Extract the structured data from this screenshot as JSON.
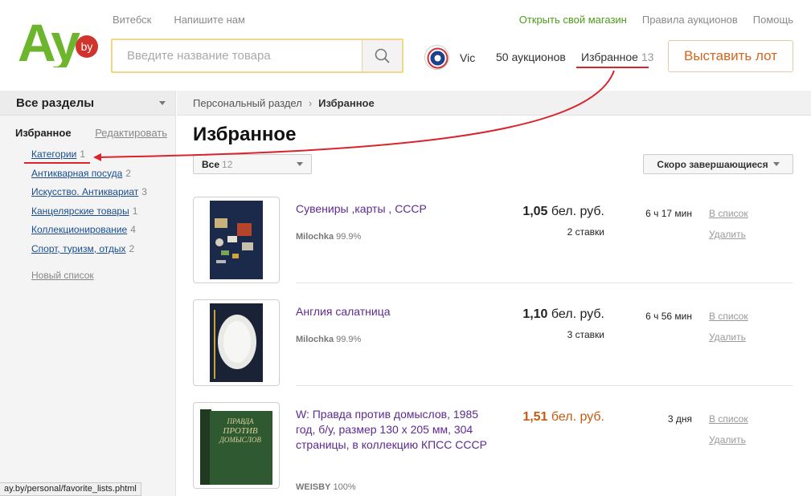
{
  "header": {
    "logo_text": "Ay",
    "logo_badge": "by",
    "city": "Витебск",
    "contact": "Напишите нам",
    "open_shop": "Открыть свой магазин",
    "rules": "Правила аукционов",
    "help": "Помощь",
    "search_placeholder": "Введите название товара",
    "user_name": "Vic",
    "auctions": "50 аукционов",
    "favorites_label": "Избранное",
    "favorites_count": "13",
    "sell_button": "Выставить лот"
  },
  "sidebar": {
    "sections": "Все разделы",
    "favorites_title": "Избранное",
    "edit": "Редактировать",
    "items": [
      {
        "label": "Категории",
        "count": "1"
      },
      {
        "label": "Антикварная посуда",
        "count": "2"
      },
      {
        "label": "Искусство. Антиквариат",
        "count": "3"
      },
      {
        "label": "Канцелярские товары",
        "count": "1"
      },
      {
        "label": "Коллекционирование",
        "count": "4"
      },
      {
        "label": "Спорт, туризм, отдых",
        "count": "2"
      }
    ],
    "new_list": "Новый список"
  },
  "main": {
    "breadcrumb_root": "Персональный раздел",
    "breadcrumb_current": "Избранное",
    "title": "Избранное",
    "filter_label": "Все",
    "filter_count": "12",
    "sort_label": "Скоро завершающиеся"
  },
  "lots": [
    {
      "title": "Сувениры ,карты , СССР",
      "seller": "Milochka",
      "rating": "99.9%",
      "price_value": "1,05",
      "price_currency": "бел. руб.",
      "bids": "2 ставки",
      "time_left": "6 ч 17 мин",
      "action_list": "В список",
      "action_delete": "Удалить",
      "price_color": "#222222"
    },
    {
      "title": "Англия салатница",
      "seller": "Milochka",
      "rating": "99.9%",
      "price_value": "1,10",
      "price_currency": "бел. руб.",
      "bids": "3 ставки",
      "time_left": "6 ч 56 мин",
      "action_list": "В список",
      "action_delete": "Удалить",
      "price_color": "#222222"
    },
    {
      "title": "W: Правда против домыслов, 1985 год, б/у, размер 130 х 205 мм, 304 страницы, в коллекцию КПСС СССР",
      "seller": "WEISBY",
      "rating": "100%",
      "price_value": "1,51",
      "price_currency": "бел. руб.",
      "bids": "",
      "time_left": "3 дня",
      "action_list": "В список",
      "action_delete": "Удалить",
      "price_color": "#c35b12"
    }
  ],
  "book_cover_text": [
    "ПРАВДА",
    "ПРОТИВ",
    "ДОМЫСЛОВ"
  ],
  "status_url": "ay.by/personal/favorite_lists.phtml",
  "colors": {
    "brand_green": "#6cb52d",
    "brand_red": "#d0342c",
    "accent_orange": "#d4661e",
    "annotation_red": "#d9232d"
  }
}
